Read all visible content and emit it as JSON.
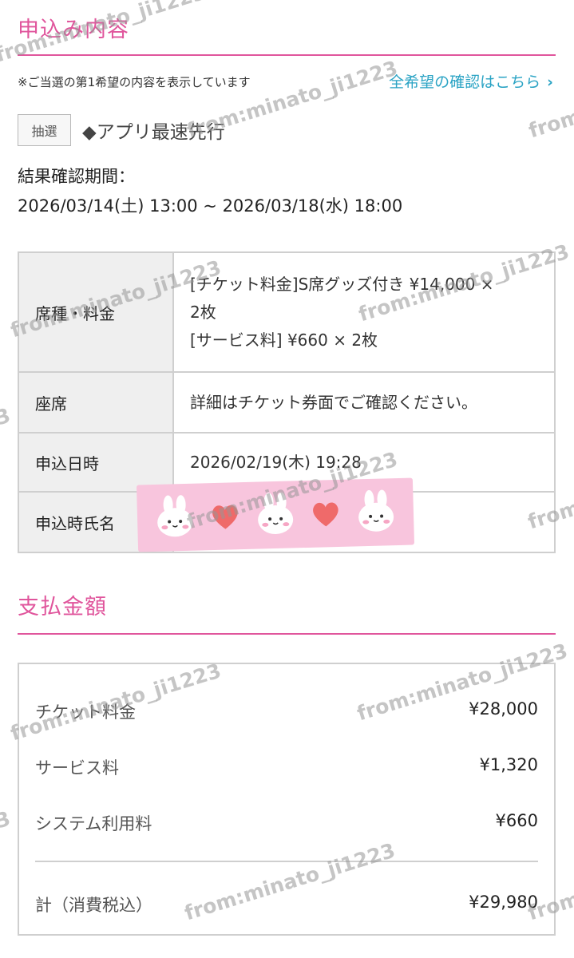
{
  "application": {
    "title": "申込み内容",
    "note": "※ご当選の第1希望の内容を表示しています",
    "all_choices_link": "全希望の確認はこちら",
    "tag": "抽選",
    "lottery_name": "◆アプリ最速先行",
    "period_label": "結果確認期間：",
    "period_value": "2026/03/14(土) 13:00 ~ 2026/03/18(水) 18:00"
  },
  "details": [
    {
      "header": "席種・料金",
      "lines": [
        "[チケット料金]S席グッズ付き ¥14,000 ×",
        "2枚",
        "[サービス料] ¥660 × 2枚"
      ]
    },
    {
      "header": "座席",
      "lines": [
        "詳細はチケット券面でご確認ください。"
      ]
    },
    {
      "header": "申込日時",
      "lines": [
        "2026/02/19(木) 19:28"
      ]
    },
    {
      "header": "申込時氏名",
      "lines": [
        ""
      ]
    }
  ],
  "payment": {
    "title": "支払金額",
    "rows": [
      {
        "label": "チケット料金",
        "amount": "¥28,000"
      },
      {
        "label": "サービス料",
        "amount": "¥1,320"
      },
      {
        "label": "システム利用料",
        "amount": "¥660"
      }
    ],
    "total_label": "計（消費税込）",
    "total_amount": "¥29,980"
  },
  "watermark_text": "from:minato_ji1223",
  "colors": {
    "accent": "#e0559c",
    "link": "#2aa3c4",
    "tape": "#f8c5dd"
  }
}
